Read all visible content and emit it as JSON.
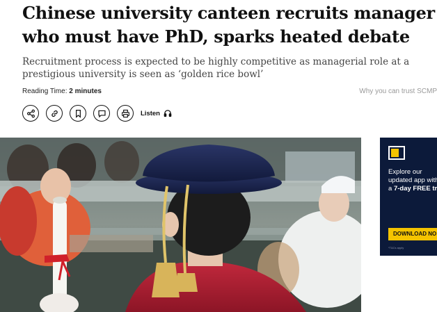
{
  "article": {
    "headline": "Chinese university canteen recruits manager who must have PhD, sparks heated debate",
    "subhead": "Recruitment process is expected to be highly competitive as managerial role at a prestigious university is seen as ‘golden rice bowl’",
    "reading_time_label": "Reading Time:",
    "reading_time_value": "2 minutes",
    "trust_link": "Why you can trust SCMP"
  },
  "actions": [
    {
      "name": "share",
      "icon": "share-icon"
    },
    {
      "name": "copy-link",
      "icon": "link-icon"
    },
    {
      "name": "bookmark",
      "icon": "bookmark-icon"
    },
    {
      "name": "comment",
      "icon": "comment-icon"
    },
    {
      "name": "print",
      "icon": "print-icon"
    }
  ],
  "listen": {
    "label": "Listen",
    "icon": "headphones-icon"
  },
  "ad": {
    "line1": "Explore our",
    "line2": "updated app with",
    "line3_prefix": "a ",
    "line3_bold": "7-day FREE tr",
    "button": "DOWNLOAD NO",
    "fine_print": "*T&Cs apply",
    "colors": {
      "background": "#0c1a3a",
      "accent": "#f5c400"
    }
  },
  "colors": {
    "headline": "#111111",
    "subhead": "#444444",
    "muted": "#999999"
  }
}
